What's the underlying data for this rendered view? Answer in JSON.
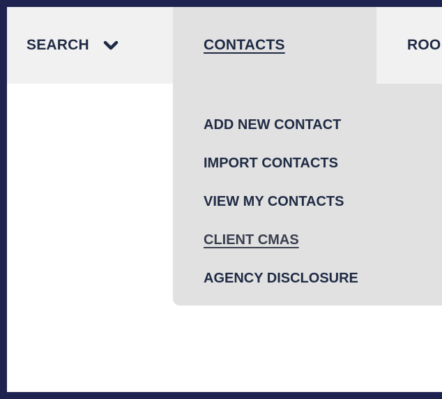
{
  "nav": {
    "search_label": "SEARCH",
    "search_icon": "chevron-down-icon",
    "contacts_label": "CONTACTS",
    "rooms_label_visible": "ROO"
  },
  "dropdown": {
    "items": [
      {
        "label": "ADD NEW CONTACT"
      },
      {
        "label": "IMPORT CONTACTS"
      },
      {
        "label": "VIEW MY CONTACTS"
      },
      {
        "label": "CLIENT CMAS",
        "active": true
      },
      {
        "label": "AGENCY DISCLOSURE"
      }
    ]
  },
  "colors": {
    "frame": "#1e2350",
    "nav_bg": "#f1f1f1",
    "menu_bg": "#e1e1e1",
    "text": "#1f2a44"
  }
}
